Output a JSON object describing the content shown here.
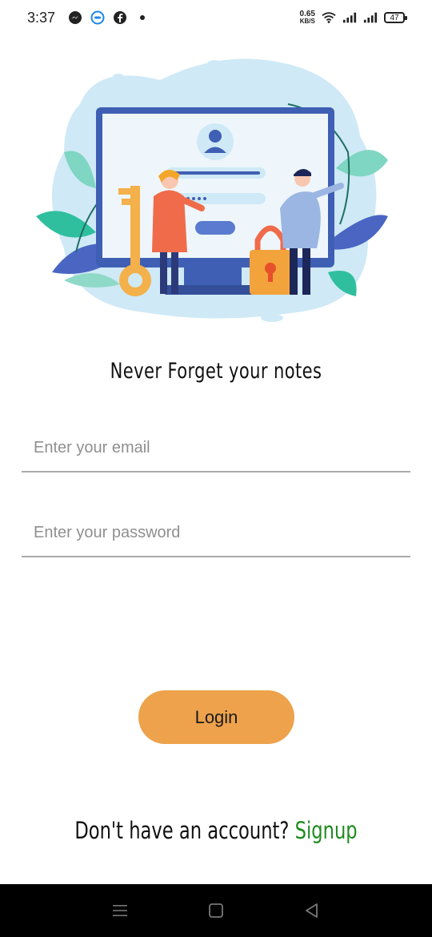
{
  "status_bar": {
    "time": "3:37",
    "speed_value": "0.65",
    "speed_unit": "KB/S",
    "battery": "47",
    "icons": [
      "messenger-icon",
      "messages-icon",
      "facebook-icon",
      "wifi-icon",
      "signal-icon",
      "battery-icon"
    ]
  },
  "illustration": {
    "icon": "login-illustration",
    "colors": {
      "blob": "#cfe9f6",
      "screen_frame": "#3f5fb4",
      "key": "#f4b04a",
      "lock": "#f3a33b",
      "leaf_teal": "#2fbf9f",
      "leaf_blue": "#4a66c2"
    }
  },
  "headline": "Never Forget your notes",
  "form": {
    "email_placeholder": "Enter your email",
    "password_placeholder": "Enter your password",
    "login_label": "Login"
  },
  "signup": {
    "prompt": "Don't have an account?",
    "link": "Signup",
    "link_color": "#1f8b1f"
  },
  "colors": {
    "login_button": "#eda24b",
    "underline": "#a9a9a9"
  },
  "nav_bar": {
    "icons": [
      "menu-icon",
      "home-icon",
      "back-icon"
    ]
  }
}
